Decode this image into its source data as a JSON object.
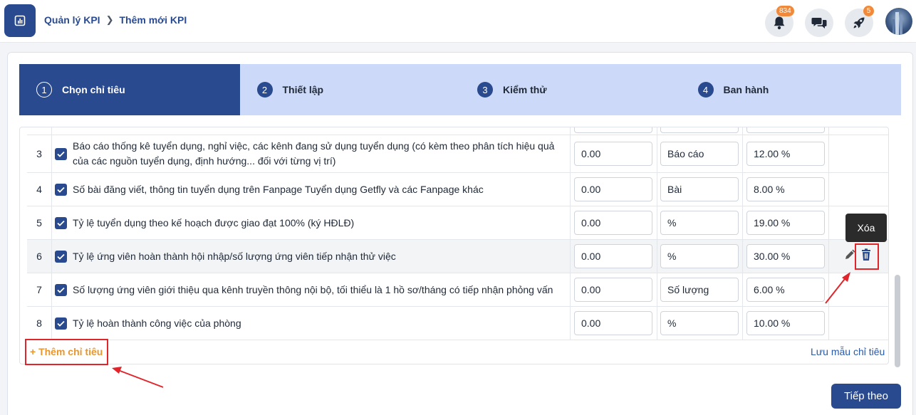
{
  "breadcrumb": {
    "parent": "Quản lý KPI",
    "current": "Thêm mới KPI"
  },
  "header": {
    "notifications_count": "834",
    "rocket_count": "5"
  },
  "steps": [
    {
      "num": "1",
      "label": "Chọn chỉ tiêu"
    },
    {
      "num": "2",
      "label": "Thiết lập"
    },
    {
      "num": "3",
      "label": "Kiểm thử"
    },
    {
      "num": "4",
      "label": "Ban hành"
    }
  ],
  "rows": [
    {
      "num": "3",
      "name": "Báo cáo thống kê tuyển dụng, nghỉ việc, các kênh đang sử dụng tuyển dụng (có kèm theo phân tích hiệu quả của các nguồn tuyển dụng, định hướng... đối với từng vị trí)",
      "value": "0.00",
      "unit": "Báo cáo",
      "weight": "12.00 %"
    },
    {
      "num": "4",
      "name": "Số bài đăng viết, thông tin tuyển dụng trên Fanpage Tuyển dụng Getfly và các Fanpage khác",
      "value": "0.00",
      "unit": "Bài",
      "weight": "8.00 %"
    },
    {
      "num": "5",
      "name": "Tỷ lệ tuyển dụng theo kế hoạch được giao đạt 100% (ký HĐLĐ)",
      "value": "0.00",
      "unit": "%",
      "weight": "19.00 %"
    },
    {
      "num": "6",
      "name": "Tỷ lệ ứng viên hoàn thành hội nhập/số lượng ứng viên tiếp nhận thử việc",
      "value": "0.00",
      "unit": "%",
      "weight": "30.00 %"
    },
    {
      "num": "7",
      "name": "Số lượng ứng viên giới thiệu qua kênh truyền thông nội bộ, tối thiểu là 1 hồ sơ/tháng có tiếp nhận phỏng vấn",
      "value": "0.00",
      "unit": "Số lượng",
      "weight": "6.00 %"
    },
    {
      "num": "8",
      "name": "Tỷ lệ hoàn thành công việc của phòng",
      "value": "0.00",
      "unit": "%",
      "weight": "10.00 %"
    }
  ],
  "tooltip": {
    "delete": "Xóa"
  },
  "actions": {
    "add_kpi": "+ Thêm chỉ tiêu",
    "save_template": "Lưu mẫu chỉ tiêu",
    "next": "Tiếp theo"
  },
  "colors": {
    "primary": "#2a4a8f",
    "step_inactive": "#cdd9f8",
    "accent_orange": "#e8962e",
    "highlight_red": "#e0252b",
    "badge": "#f08a3a"
  }
}
